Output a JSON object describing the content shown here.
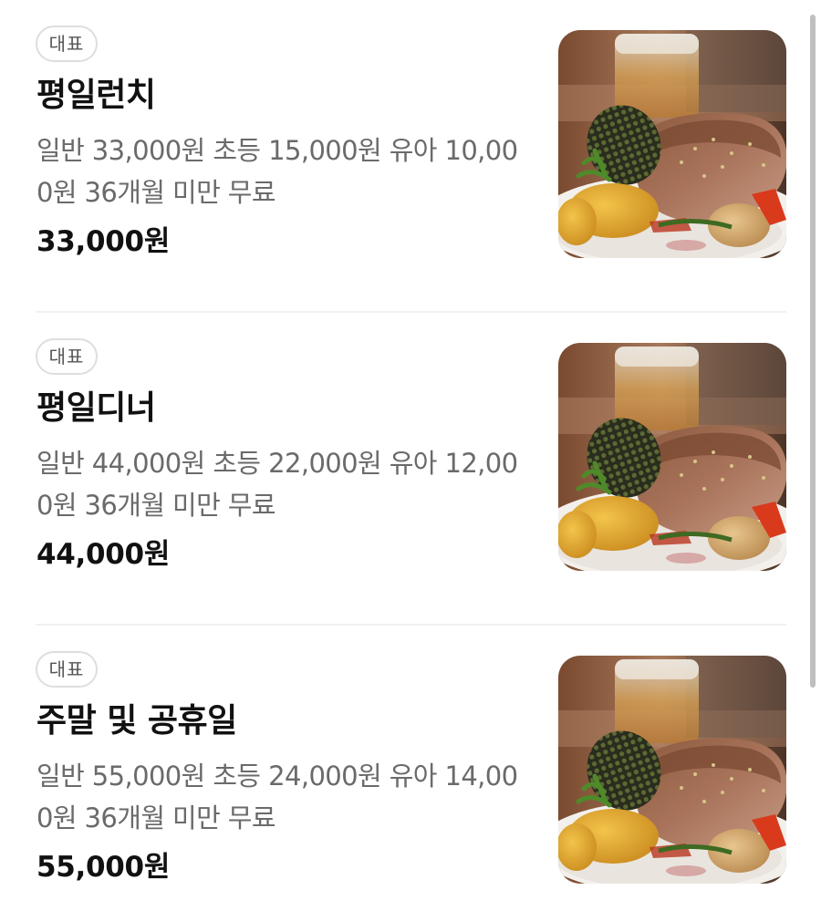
{
  "menu_items": [
    {
      "badge": "대표",
      "name": "평일런치",
      "description": "일반 33,000원 초등 15,000원 유아 10,000원 36개월 미만 무료",
      "price": "33,000원",
      "photo_icon": "steak-dish-photo"
    },
    {
      "badge": "대표",
      "name": "평일디너",
      "description": "일반 44,000원 초등 22,000원 유아 12,000원 36개월 미만 무료",
      "price": "44,000원",
      "photo_icon": "steak-dish-photo"
    },
    {
      "badge": "대표",
      "name": "주말 및 공휴일",
      "description": "일반 55,000원 초등 24,000원 유아 14,000원 36개월 미만 무료",
      "price": "55,000원",
      "photo_icon": "steak-dish-photo"
    }
  ],
  "colors": {
    "text_primary": "#111111",
    "text_secondary": "#6a6a6a",
    "badge_border": "#dedede",
    "divider": "#f1f1f1",
    "scrollbar": "#bfbfbf"
  }
}
